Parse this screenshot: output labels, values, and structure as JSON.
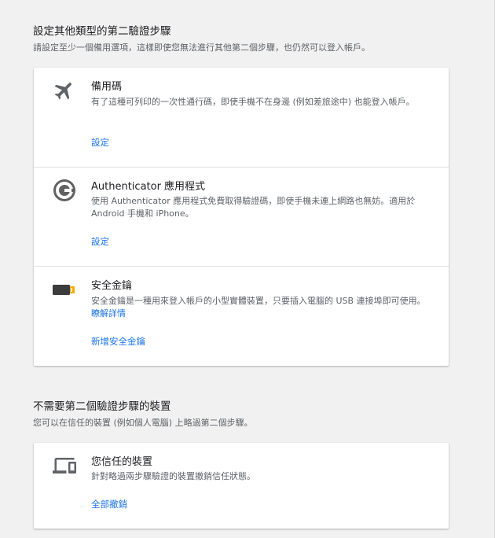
{
  "section1": {
    "title": "設定其他類型的第二驗證步驟",
    "description": "請設定至少一個備用選項，這樣即使您無法進行其他第二個步驟，也仍然可以登入帳戶。"
  },
  "methods": [
    {
      "icon": "airplane-icon",
      "title": "備用碼",
      "description": "有了這種可列印的一次性通行碼，即使手機不在身邊 (例如差旅途中) 也能登入帳戶。",
      "action": "設定"
    },
    {
      "icon": "authenticator-icon",
      "title": "Authenticator 應用程式",
      "description": "使用 Authenticator 應用程式免費取得驗證碼，即使手機未連上網路也無妨。適用於 Android 手機和 iPhone。",
      "action": "設定"
    },
    {
      "icon": "security-key-icon",
      "title": "安全金鑰",
      "description": "安全金鑰是一種用來登入帳戶的小型實體裝置，只要插入電腦的 USB 連接埠即可使用。",
      "learn_more": "瞭解詳情",
      "action": "新增安全金鑰"
    }
  ],
  "section2": {
    "title": "不需要第二個驗證步驟的裝置",
    "description": "您可以在信任的裝置 (例如個人電腦) 上略過第二個步驟。"
  },
  "trusted": {
    "icon": "devices-icon",
    "title": "您信任的裝置",
    "description": "針對略過兩步驟驗證的裝置撤銷信任狀態。",
    "action": "全部撤銷"
  },
  "colors": {
    "link": "#1a73e8",
    "background": "#f1f1f1",
    "card": "#ffffff"
  }
}
